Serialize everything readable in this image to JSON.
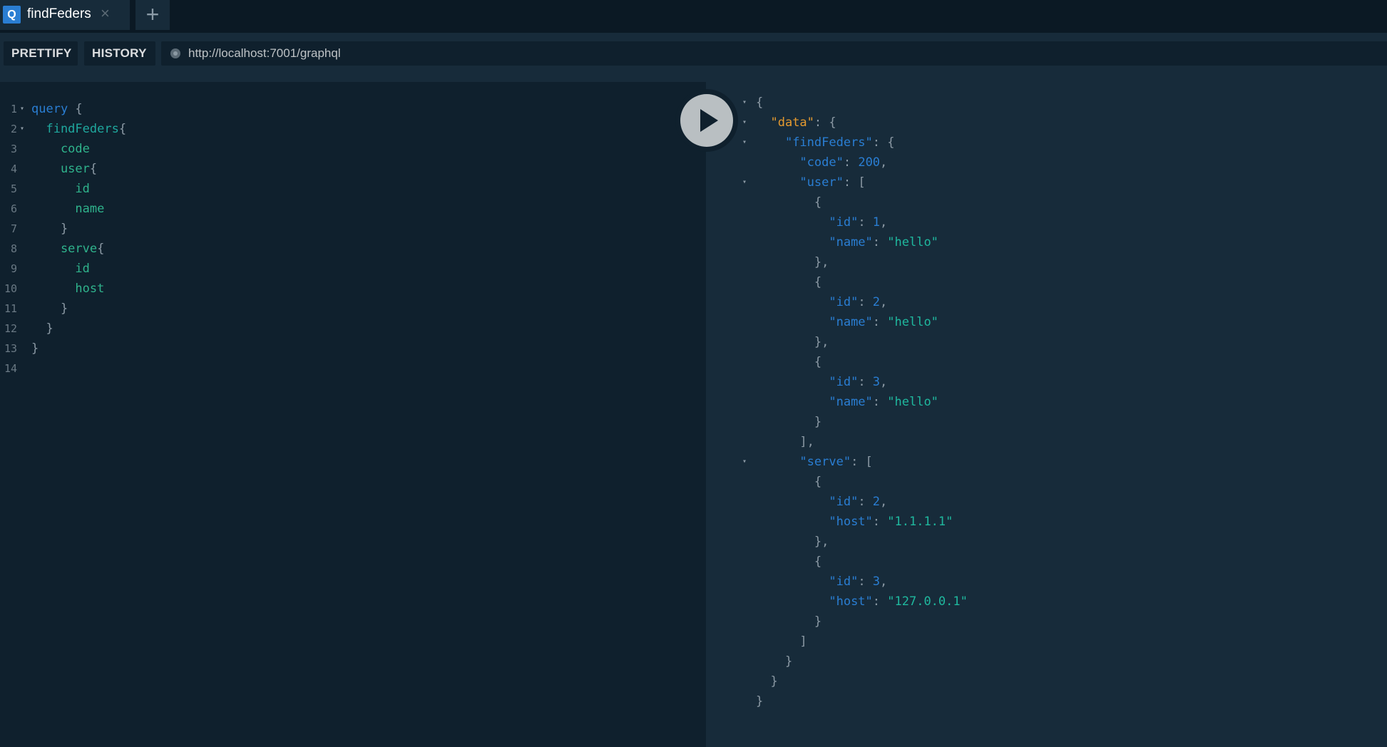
{
  "tabs": [
    {
      "badge": "Q",
      "title": "findFeders",
      "close": "×"
    }
  ],
  "add_tab": "+",
  "toolbar": {
    "prettify_label": "PRETTIFY",
    "history_label": "HISTORY",
    "endpoint_url": "http://localhost:7001/graphql"
  },
  "editor": {
    "lines": [
      {
        "n": "1",
        "fold": true,
        "tokens": [
          [
            "kw",
            "query"
          ],
          [
            "punc",
            " {"
          ]
        ]
      },
      {
        "n": "2",
        "fold": true,
        "tokens": [
          [
            "fld",
            "  findFeders"
          ],
          [
            "punc",
            "{"
          ]
        ]
      },
      {
        "n": "3",
        "fold": false,
        "tokens": [
          [
            "fld2",
            "    code"
          ]
        ]
      },
      {
        "n": "4",
        "fold": false,
        "tokens": [
          [
            "fld2",
            "    user"
          ],
          [
            "punc",
            "{"
          ]
        ]
      },
      {
        "n": "5",
        "fold": false,
        "tokens": [
          [
            "fld2",
            "      id"
          ]
        ]
      },
      {
        "n": "6",
        "fold": false,
        "tokens": [
          [
            "fld2",
            "      name"
          ]
        ]
      },
      {
        "n": "7",
        "fold": false,
        "tokens": [
          [
            "punc",
            "    }"
          ]
        ]
      },
      {
        "n": "8",
        "fold": false,
        "tokens": [
          [
            "fld2",
            "    serve"
          ],
          [
            "punc",
            "{"
          ]
        ]
      },
      {
        "n": "9",
        "fold": false,
        "tokens": [
          [
            "fld2",
            "      id"
          ]
        ]
      },
      {
        "n": "10",
        "fold": false,
        "tokens": [
          [
            "fld2",
            "      host"
          ]
        ]
      },
      {
        "n": "11",
        "fold": false,
        "tokens": [
          [
            "punc",
            "    }"
          ]
        ]
      },
      {
        "n": "12",
        "fold": false,
        "tokens": [
          [
            "punc",
            "  }"
          ]
        ]
      },
      {
        "n": "13",
        "fold": false,
        "tokens": [
          [
            "punc",
            "}"
          ]
        ]
      },
      {
        "n": "14",
        "fold": false,
        "tokens": []
      }
    ]
  },
  "result": {
    "lines": [
      {
        "fold": true,
        "tokens": [
          [
            "punc",
            "{"
          ]
        ]
      },
      {
        "fold": true,
        "tokens": [
          [
            "punc",
            "  "
          ],
          [
            "datakey",
            "\"data\""
          ],
          [
            "punc",
            ": {"
          ]
        ]
      },
      {
        "fold": true,
        "tokens": [
          [
            "punc",
            "    "
          ],
          [
            "key",
            "\"findFeders\""
          ],
          [
            "punc",
            ": {"
          ]
        ]
      },
      {
        "fold": false,
        "tokens": [
          [
            "punc",
            "      "
          ],
          [
            "key",
            "\"code\""
          ],
          [
            "punc",
            ": "
          ],
          [
            "num",
            "200"
          ],
          [
            "punc",
            ","
          ]
        ]
      },
      {
        "fold": true,
        "tokens": [
          [
            "punc",
            "      "
          ],
          [
            "key",
            "\"user\""
          ],
          [
            "punc",
            ": ["
          ]
        ]
      },
      {
        "fold": false,
        "tokens": [
          [
            "punc",
            "        {"
          ]
        ]
      },
      {
        "fold": false,
        "tokens": [
          [
            "punc",
            "          "
          ],
          [
            "key",
            "\"id\""
          ],
          [
            "punc",
            ": "
          ],
          [
            "num",
            "1"
          ],
          [
            "punc",
            ","
          ]
        ]
      },
      {
        "fold": false,
        "tokens": [
          [
            "punc",
            "          "
          ],
          [
            "key",
            "\"name\""
          ],
          [
            "punc",
            ": "
          ],
          [
            "str",
            "\"hello\""
          ]
        ]
      },
      {
        "fold": false,
        "tokens": [
          [
            "punc",
            "        },"
          ]
        ]
      },
      {
        "fold": false,
        "tokens": [
          [
            "punc",
            "        {"
          ]
        ]
      },
      {
        "fold": false,
        "tokens": [
          [
            "punc",
            "          "
          ],
          [
            "key",
            "\"id\""
          ],
          [
            "punc",
            ": "
          ],
          [
            "num",
            "2"
          ],
          [
            "punc",
            ","
          ]
        ]
      },
      {
        "fold": false,
        "tokens": [
          [
            "punc",
            "          "
          ],
          [
            "key",
            "\"name\""
          ],
          [
            "punc",
            ": "
          ],
          [
            "str",
            "\"hello\""
          ]
        ]
      },
      {
        "fold": false,
        "tokens": [
          [
            "punc",
            "        },"
          ]
        ]
      },
      {
        "fold": false,
        "tokens": [
          [
            "punc",
            "        {"
          ]
        ]
      },
      {
        "fold": false,
        "tokens": [
          [
            "punc",
            "          "
          ],
          [
            "key",
            "\"id\""
          ],
          [
            "punc",
            ": "
          ],
          [
            "num",
            "3"
          ],
          [
            "punc",
            ","
          ]
        ]
      },
      {
        "fold": false,
        "tokens": [
          [
            "punc",
            "          "
          ],
          [
            "key",
            "\"name\""
          ],
          [
            "punc",
            ": "
          ],
          [
            "str",
            "\"hello\""
          ]
        ]
      },
      {
        "fold": false,
        "tokens": [
          [
            "punc",
            "        }"
          ]
        ]
      },
      {
        "fold": false,
        "tokens": [
          [
            "punc",
            "      ],"
          ]
        ]
      },
      {
        "fold": true,
        "tokens": [
          [
            "punc",
            "      "
          ],
          [
            "key",
            "\"serve\""
          ],
          [
            "punc",
            ": ["
          ]
        ]
      },
      {
        "fold": false,
        "tokens": [
          [
            "punc",
            "        {"
          ]
        ]
      },
      {
        "fold": false,
        "tokens": [
          [
            "punc",
            "          "
          ],
          [
            "key",
            "\"id\""
          ],
          [
            "punc",
            ": "
          ],
          [
            "num",
            "2"
          ],
          [
            "punc",
            ","
          ]
        ]
      },
      {
        "fold": false,
        "tokens": [
          [
            "punc",
            "          "
          ],
          [
            "key",
            "\"host\""
          ],
          [
            "punc",
            ": "
          ],
          [
            "str",
            "\"1.1.1.1\""
          ]
        ]
      },
      {
        "fold": false,
        "tokens": [
          [
            "punc",
            "        },"
          ]
        ]
      },
      {
        "fold": false,
        "tokens": [
          [
            "punc",
            "        {"
          ]
        ]
      },
      {
        "fold": false,
        "tokens": [
          [
            "punc",
            "          "
          ],
          [
            "key",
            "\"id\""
          ],
          [
            "punc",
            ": "
          ],
          [
            "num",
            "3"
          ],
          [
            "punc",
            ","
          ]
        ]
      },
      {
        "fold": false,
        "tokens": [
          [
            "punc",
            "          "
          ],
          [
            "key",
            "\"host\""
          ],
          [
            "punc",
            ": "
          ],
          [
            "str",
            "\"127.0.0.1\""
          ]
        ]
      },
      {
        "fold": false,
        "tokens": [
          [
            "punc",
            "        }"
          ]
        ]
      },
      {
        "fold": false,
        "tokens": [
          [
            "punc",
            "      ]"
          ]
        ]
      },
      {
        "fold": false,
        "tokens": [
          [
            "punc",
            "    }"
          ]
        ]
      },
      {
        "fold": false,
        "tokens": [
          [
            "punc",
            "  }"
          ]
        ]
      },
      {
        "fold": false,
        "tokens": [
          [
            "punc",
            "}"
          ]
        ]
      }
    ]
  },
  "colors": {
    "keyword": "#2a7ed3",
    "field": "#2fb38c",
    "data_key": "#e59a2f",
    "string": "#1fb89e",
    "number": "#2a7ed3",
    "background": "#172b3a",
    "editor_background": "#0f202d"
  },
  "icons": {
    "tab_badge": "q-badge-icon",
    "close": "close-icon",
    "add": "plus-icon",
    "play": "play-icon",
    "status": "status-dot-icon",
    "fold": "fold-arrow-icon"
  }
}
